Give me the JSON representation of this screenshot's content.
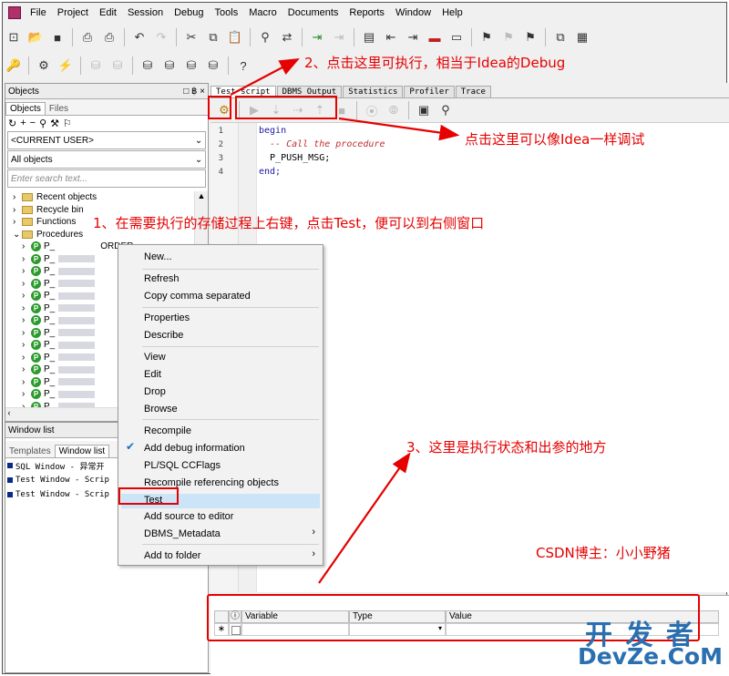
{
  "menu": [
    "File",
    "Project",
    "Edit",
    "Session",
    "Debug",
    "Tools",
    "Macro",
    "Documents",
    "Reports",
    "Window",
    "Help"
  ],
  "objects_panel": {
    "title": "Objects",
    "title_controls": "□ ฿ ×",
    "tabs": [
      "Objects",
      "Files"
    ],
    "user_combo": "<CURRENT USER>",
    "objects_combo": "All objects",
    "search_placeholder": "Enter search text...",
    "tree": [
      "Recent objects",
      "Recycle bin",
      "Functions",
      "Procedures"
    ],
    "proc_prefix": "P_",
    "proc_suffix": "ORDER"
  },
  "window_list": {
    "title": "Window list",
    "tabs": [
      "Templates",
      "Window list"
    ],
    "items": [
      "SQL Window - 异常开",
      "Test Window - Scrip",
      "Test Window - Scrip"
    ]
  },
  "editor": {
    "tabs": [
      "Test script",
      "DBMS Output",
      "Statistics",
      "Profiler",
      "Trace"
    ],
    "line_numbers": [
      "1",
      "2",
      "3",
      "4"
    ],
    "code": [
      "begin",
      "  -- Call the procedure",
      "  P_PUSH_MSG;",
      "end;"
    ]
  },
  "params_grid": {
    "columns": [
      "Variable",
      "Type",
      "Value"
    ],
    "row_marker": "∗",
    "info_icon": "ⓘ"
  },
  "context_menu": {
    "items": [
      "New...",
      "Refresh",
      "Copy comma separated",
      "Properties",
      "Describe",
      "View",
      "Edit",
      "Drop",
      "Browse",
      "Recompile",
      "Add debug information",
      "PL/SQL CCFlags",
      "Recompile referencing objects",
      "Test",
      "Add source to editor",
      "DBMS_Metadata",
      "Add to folder"
    ],
    "highlighted": "Test",
    "checked": "Add debug information",
    "submenu_arrow": "›"
  },
  "annotations": {
    "a1": "1、在需要执行的存储过程上右键，点击Test，便可以到右侧窗口",
    "a2": "2、点击这里可执行，相当于Idea的Debug",
    "a_debug": "点击这里可以像Idea一样调试",
    "a3": "3、这里是执行状态和出参的地方",
    "credit": "CSDN博主：小小野猪"
  },
  "watermark": {
    "cn": "开 发 者",
    "en": "DevZe.CoM"
  },
  "colors": {
    "annotation_red": "#e60000",
    "menu_highlight": "#cce4f7",
    "proc_icon": "#2c9a2c"
  }
}
